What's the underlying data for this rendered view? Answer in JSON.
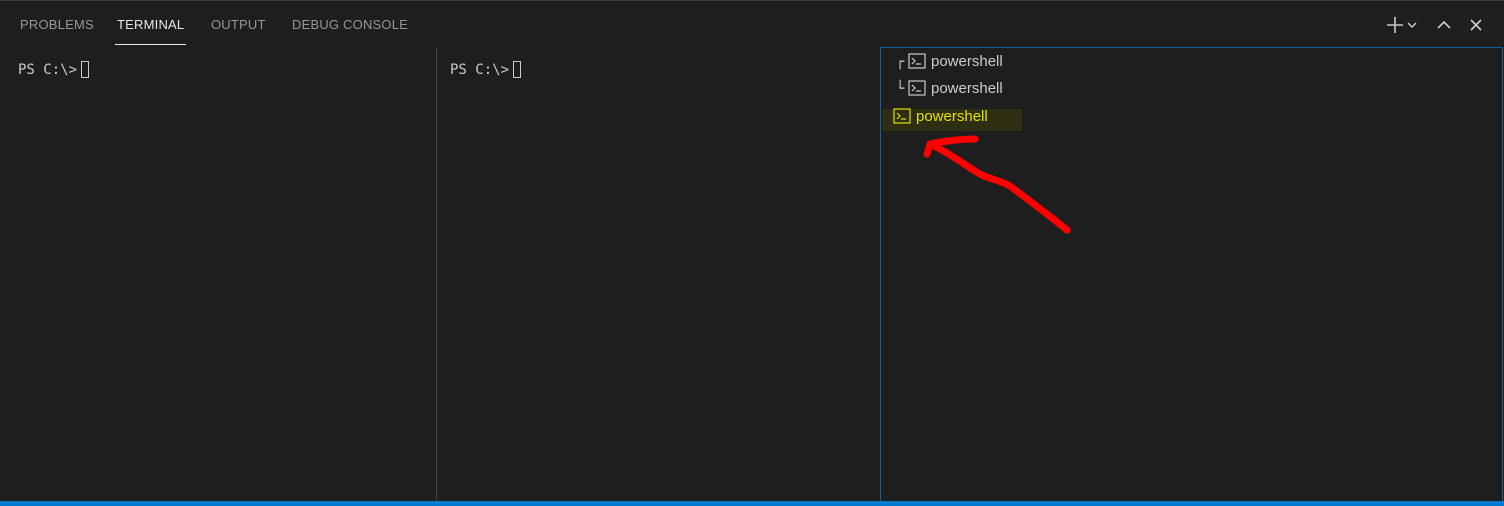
{
  "tabs": [
    {
      "label": "PROBLEMS"
    },
    {
      "label": "TERMINAL"
    },
    {
      "label": "OUTPUT"
    },
    {
      "label": "DEBUG CONSOLE"
    }
  ],
  "active_tab": "TERMINAL",
  "actions": {
    "new_terminal": "plus-icon",
    "dropdown": "chevron-down-icon",
    "maximize": "chevron-up-icon",
    "close": "close-icon"
  },
  "panes": [
    {
      "prompt": "PS C:\\>"
    },
    {
      "prompt": "PS C:\\>"
    }
  ],
  "terminal_list": {
    "items": [
      {
        "tree": "┌",
        "label": "powershell",
        "icon": "terminal-icon"
      },
      {
        "tree": "└",
        "label": "powershell",
        "icon": "terminal-icon"
      },
      {
        "tree": "",
        "label": "powershell",
        "icon": "terminal-icon"
      }
    ]
  },
  "colors": {
    "background": "#1e1e1e",
    "selected_text": "#e2e200",
    "focus_border": "#0e639c",
    "status_bar": "#007acc",
    "annotation_arrow": "#ff0000"
  }
}
